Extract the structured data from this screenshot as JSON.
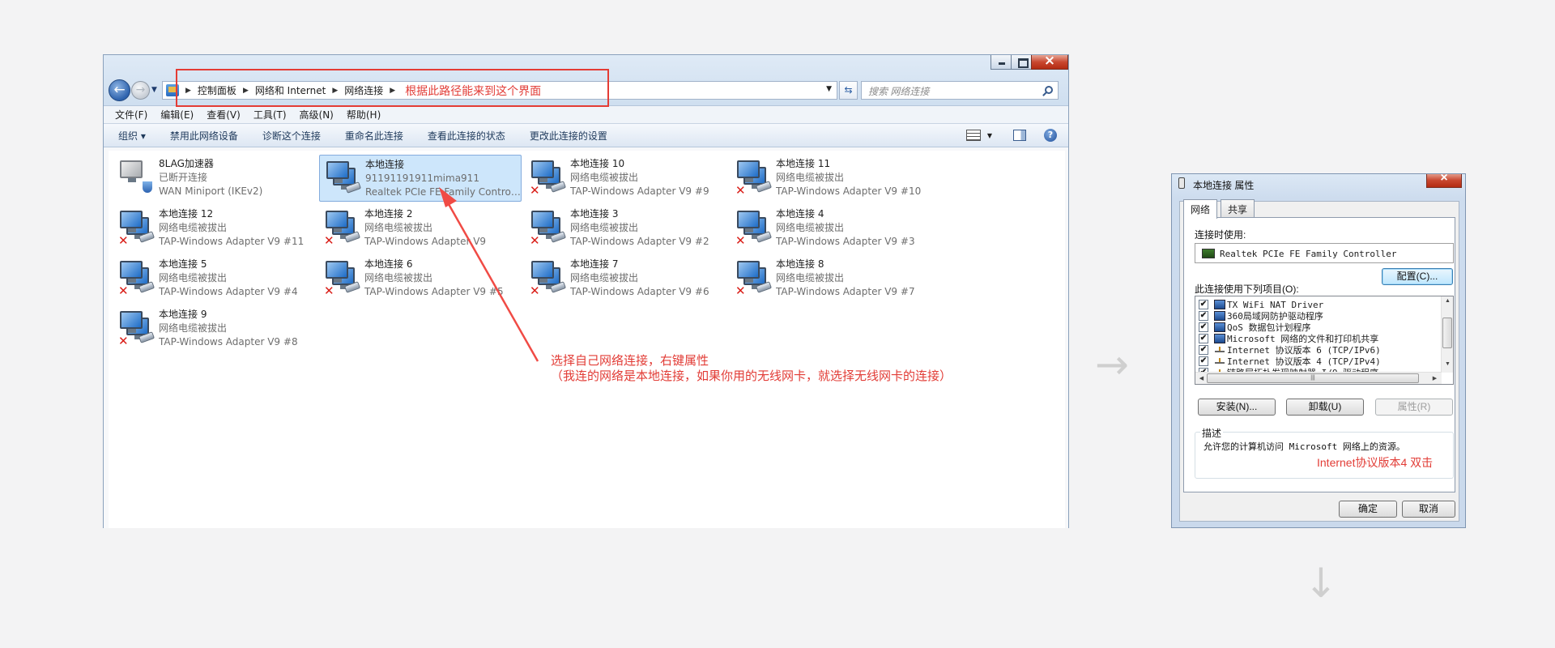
{
  "explorer": {
    "breadcrumbs": [
      "控制面板",
      "网络和 Internet",
      "网络连接"
    ],
    "address_annotation": "根据此路径能来到这个界面",
    "search_placeholder": "搜索 网络连接",
    "menu": [
      "文件(F)",
      "编辑(E)",
      "查看(V)",
      "工具(T)",
      "高级(N)",
      "帮助(H)"
    ],
    "commands": [
      "组织 ▾",
      "禁用此网络设备",
      "诊断这个连接",
      "重命名此连接",
      "查看此连接的状态",
      "更改此连接的设置"
    ],
    "connections": [
      {
        "name": "8LAG加速器",
        "status": "已断开连接",
        "adapter": "WAN Miniport (IKEv2)",
        "state": "vpn"
      },
      {
        "name": "本地连接",
        "status": "91191191911mima911",
        "adapter": "Realtek PCIe FE Family Controller",
        "state": "selected"
      },
      {
        "name": "本地连接 10",
        "status": "网络电缆被拔出",
        "adapter": "TAP-Windows Adapter V9 #9",
        "state": "unplugged"
      },
      {
        "name": "本地连接 11",
        "status": "网络电缆被拔出",
        "adapter": "TAP-Windows Adapter V9 #10",
        "state": "unplugged"
      },
      {
        "name": "本地连接 12",
        "status": "网络电缆被拔出",
        "adapter": "TAP-Windows Adapter V9 #11",
        "state": "unplugged"
      },
      {
        "name": "本地连接 2",
        "status": "网络电缆被拔出",
        "adapter": "TAP-Windows Adapter V9",
        "state": "unplugged"
      },
      {
        "name": "本地连接 3",
        "status": "网络电缆被拔出",
        "adapter": "TAP-Windows Adapter V9 #2",
        "state": "unplugged"
      },
      {
        "name": "本地连接 4",
        "status": "网络电缆被拔出",
        "adapter": "TAP-Windows Adapter V9 #3",
        "state": "unplugged"
      },
      {
        "name": "本地连接 5",
        "status": "网络电缆被拔出",
        "adapter": "TAP-Windows Adapter V9 #4",
        "state": "unplugged"
      },
      {
        "name": "本地连接 6",
        "status": "网络电缆被拔出",
        "adapter": "TAP-Windows Adapter V9 #5",
        "state": "unplugged"
      },
      {
        "name": "本地连接 7",
        "status": "网络电缆被拔出",
        "adapter": "TAP-Windows Adapter V9 #6",
        "state": "unplugged"
      },
      {
        "name": "本地连接 8",
        "status": "网络电缆被拔出",
        "adapter": "TAP-Windows Adapter V9 #7",
        "state": "unplugged"
      },
      {
        "name": "本地连接 9",
        "status": "网络电缆被拔出",
        "adapter": "TAP-Windows Adapter V9 #8",
        "state": "unplugged"
      }
    ],
    "note_line1": "选择自己网络连接，右键属性",
    "note_line2": "（我连的网络是本地连接，如果你用的无线网卡，就选择无线网卡的连接）"
  },
  "dialog": {
    "title": "本地连接 属性",
    "tabs": [
      "网络",
      "共享"
    ],
    "connect_using_label": "连接时使用:",
    "adapter": "Realtek PCIe FE Family Controller",
    "configure_button": "配置(C)...",
    "items_label": "此连接使用下列项目(O):",
    "items": [
      {
        "label": "TX WiFi NAT Driver",
        "checked": "✔"
      },
      {
        "label": "360局域网防护驱动程序",
        "checked": "✔"
      },
      {
        "label": "QoS 数据包计划程序",
        "checked": "✔"
      },
      {
        "label": "Microsoft 网络的文件和打印机共享",
        "checked": "✔"
      },
      {
        "label": "Internet 协议版本 6 (TCP/IPv6)",
        "checked": "✔"
      },
      {
        "label": "Internet 协议版本 4 (TCP/IPv4)",
        "checked": "✔"
      },
      {
        "label": "链路层拓扑发现映射器 I/O 驱动程序",
        "checked": "✔"
      }
    ],
    "install_button": "安装(N)...",
    "uninstall_button": "卸载(U)",
    "properties_button": "属性(R)",
    "description_label": "描述",
    "description_text": "允许您的计算机访问 Microsoft 网络上的资源。",
    "annotation": "Internet协议版本4 双击",
    "ok_button": "确定",
    "cancel_button": "取消"
  },
  "colors": {
    "annotation": "#e23c36",
    "selection": "#cde6fb"
  }
}
